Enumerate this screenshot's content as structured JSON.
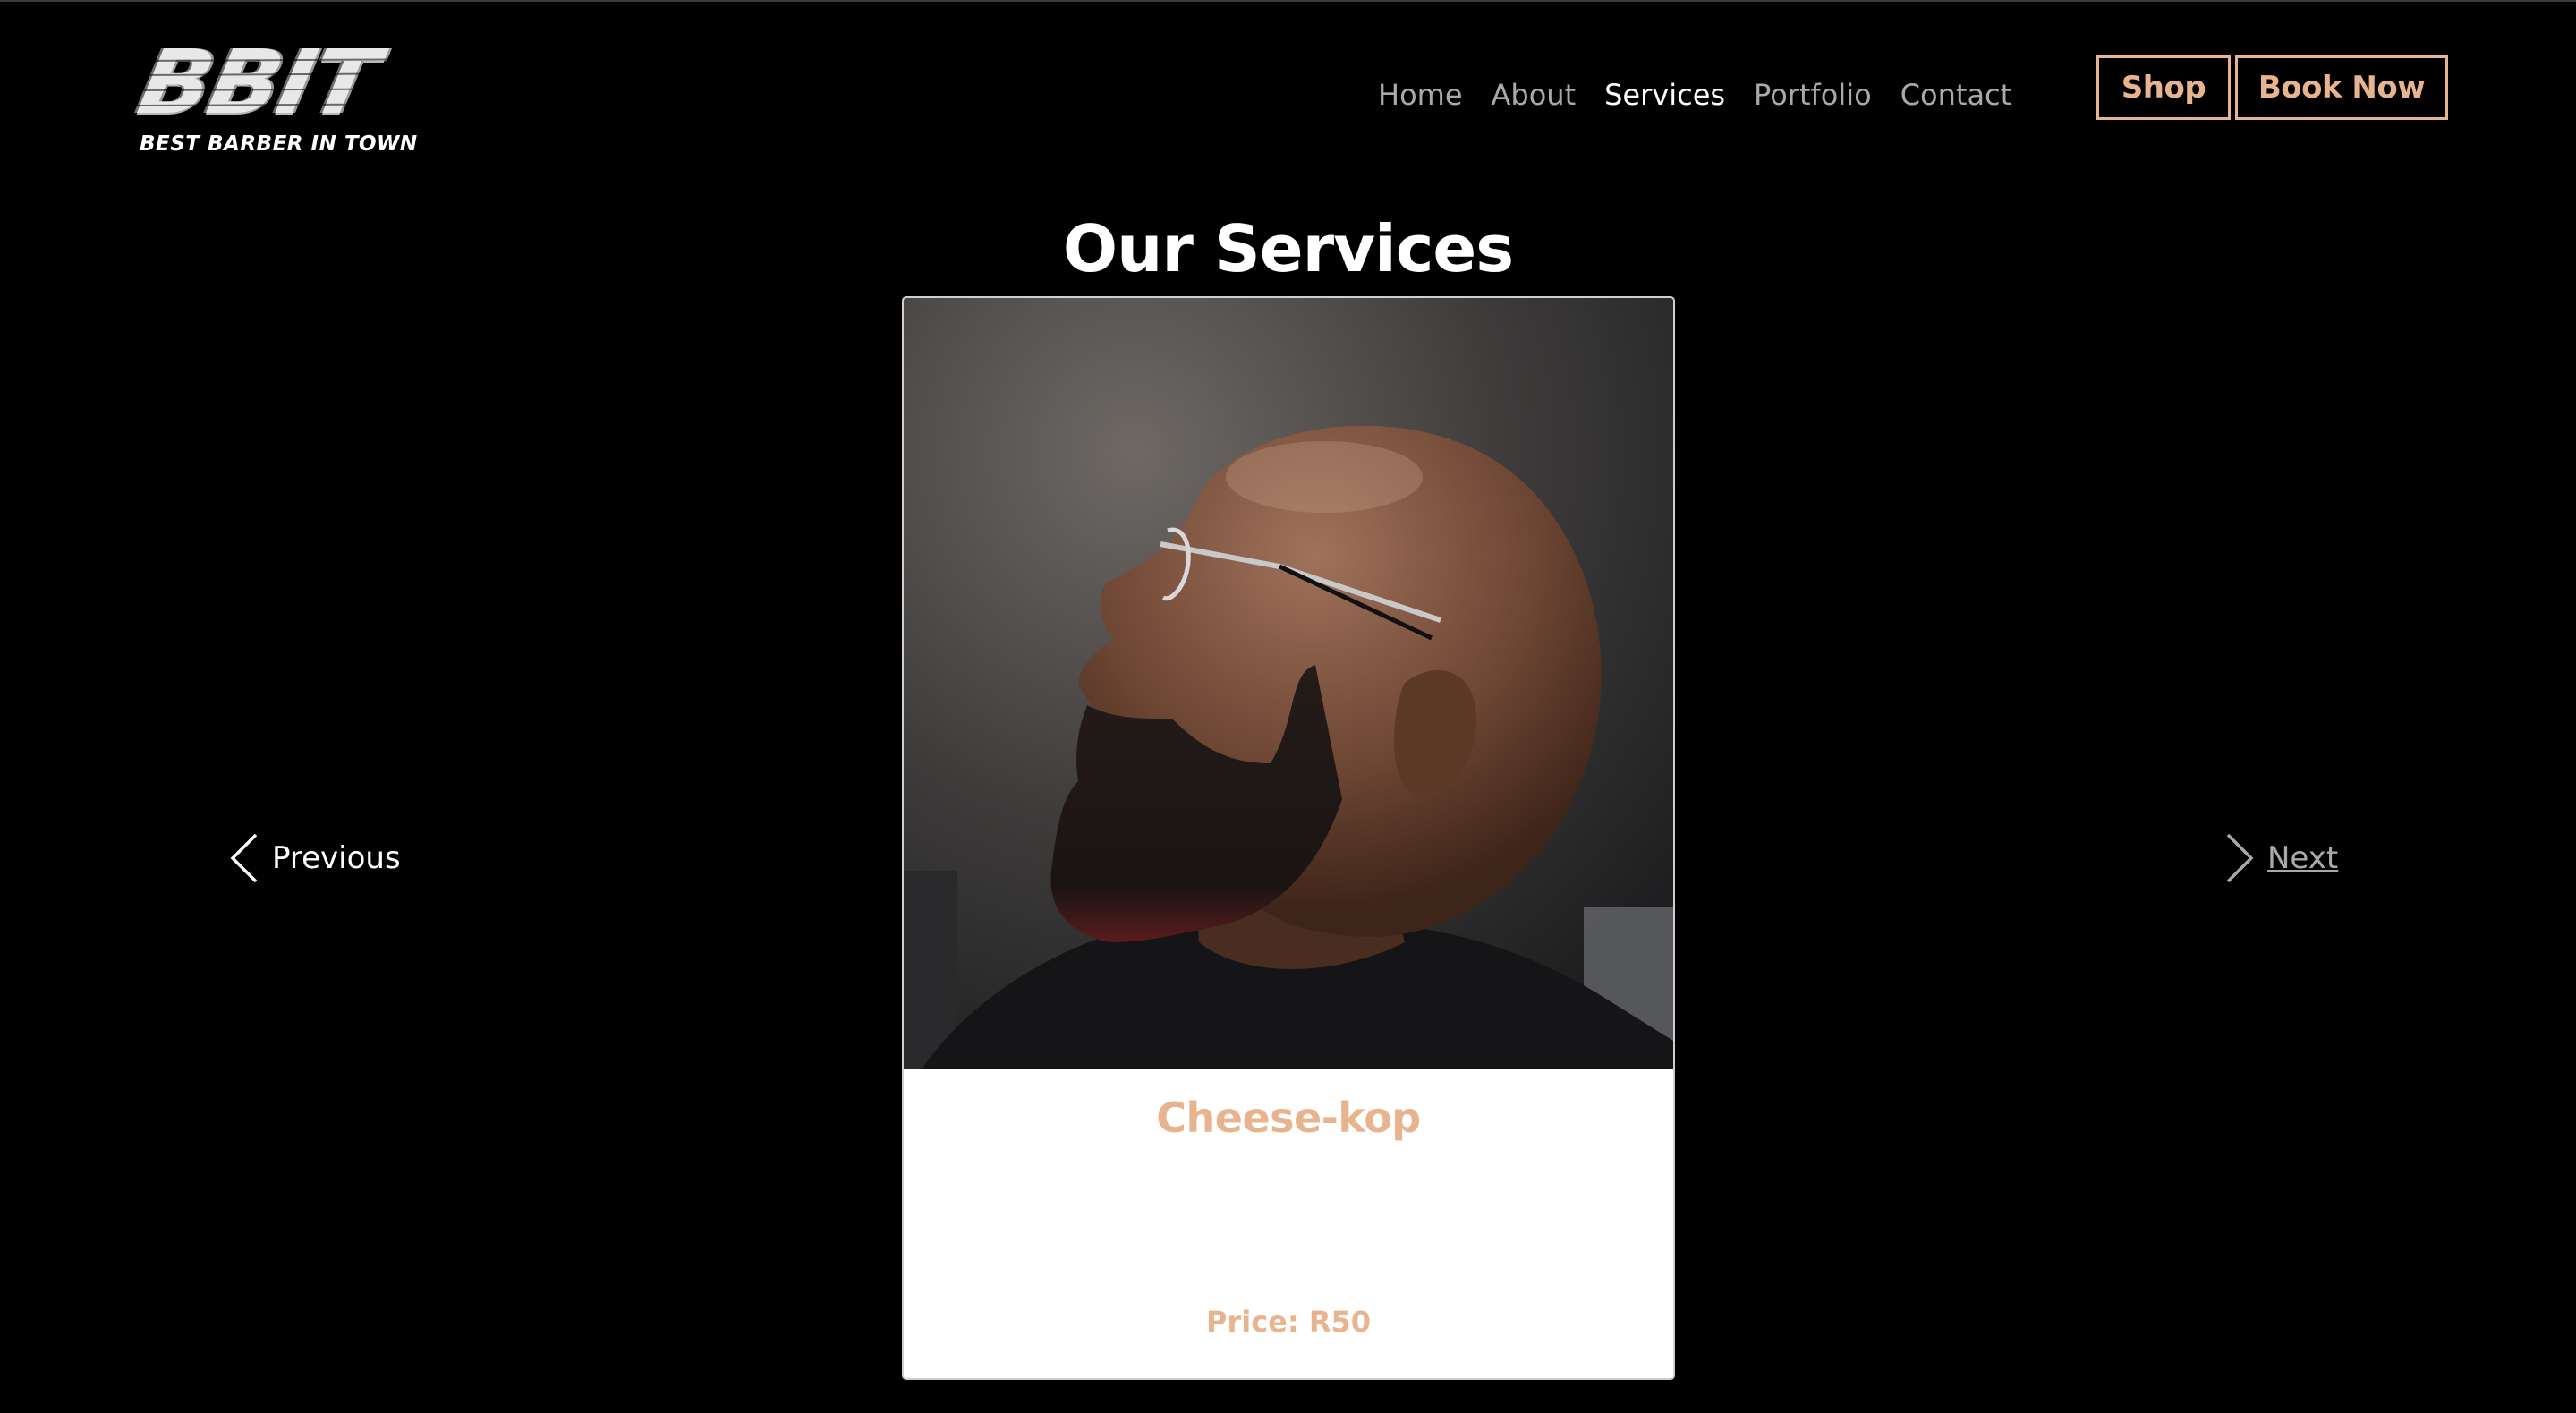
{
  "brand": {
    "logo_text": "BBIT",
    "tagline": "BEST BARBER IN TOWN"
  },
  "nav": {
    "items": [
      {
        "label": "Home",
        "active": false
      },
      {
        "label": "About",
        "active": false
      },
      {
        "label": "Services",
        "active": true
      },
      {
        "label": "Portfolio",
        "active": false
      },
      {
        "label": "Contact",
        "active": false
      }
    ],
    "shop_label": "Shop",
    "book_label": "Book Now"
  },
  "services": {
    "title": "Our Services",
    "card": {
      "name": "Cheese-kop",
      "price": "Price: R50"
    },
    "previous_label": "Previous",
    "next_label": "Next"
  },
  "colors": {
    "accent": "#e8b48f",
    "background": "#000000",
    "nav_inactive": "#a9a9a9"
  }
}
